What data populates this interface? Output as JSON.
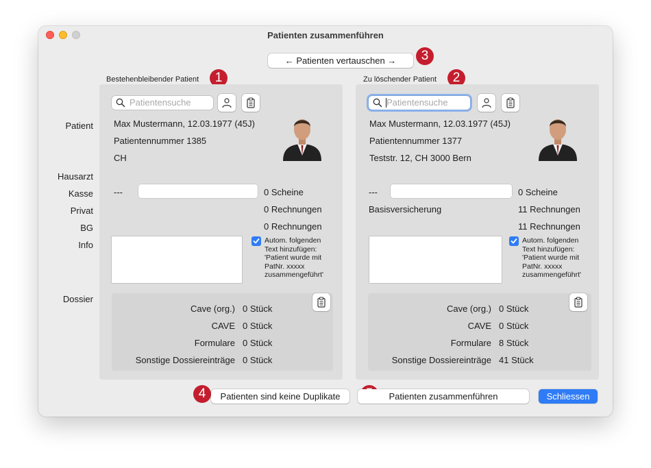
{
  "window": {
    "title": "Patienten zusammenführen"
  },
  "swap_button": "← Patienten vertauschen →",
  "badges": [
    "1",
    "2",
    "3",
    "4",
    "5"
  ],
  "row_labels": {
    "patient": "Patient",
    "hausarzt": "Hausarzt",
    "kasse": "Kasse",
    "privat": "Privat",
    "bg": "BG",
    "info": "Info",
    "dossier": "Dossier"
  },
  "search_placeholder": "Patientensuche",
  "left": {
    "heading": "Bestehenbleibender Patient",
    "name_line": "Max Mustermann, 12.03.1977 (45J)",
    "patnr_line": "Patientennummer 1385",
    "address_line": "CH",
    "kasse_value": "---",
    "kasse_insurance": "",
    "scheine": "0 Scheine",
    "privat_rechnungen": "0 Rechnungen",
    "bg_rechnungen": "0 Rechnungen",
    "auto_text": [
      "Autom. folgenden",
      "Text hinzufügen:",
      "'Patient wurde mit",
      "PatNr. xxxxx",
      "zusammengeführt'"
    ],
    "auto_checked": true,
    "dossier": [
      {
        "label": "Cave (org.)",
        "value": "0 Stück"
      },
      {
        "label": "CAVE",
        "value": "0 Stück"
      },
      {
        "label": "Formulare",
        "value": "0 Stück"
      },
      {
        "label": "Sonstige Dossiereinträge",
        "value": "0 Stück"
      }
    ]
  },
  "right": {
    "heading": "Zu löschender Patient",
    "name_line": "Max Mustermann, 12.03.1977 (45J)",
    "patnr_line": "Patientennummer 1377",
    "address_line": "Teststr. 12, CH 3000 Bern",
    "kasse_value": "---",
    "kasse_insurance": "Basisversicherung",
    "scheine": "0 Scheine",
    "privat_rechnungen": "11 Rechnungen",
    "bg_rechnungen": "11 Rechnungen",
    "auto_text": [
      "Autom. folgenden",
      "Text hinzufügen:",
      "'Patient wurde mit",
      "PatNr. xxxxx",
      "zusammengeführt'"
    ],
    "auto_checked": true,
    "dossier": [
      {
        "label": "Cave (org.)",
        "value": "0 Stück"
      },
      {
        "label": "CAVE",
        "value": "0 Stück"
      },
      {
        "label": "Formulare",
        "value": "8 Stück"
      },
      {
        "label": "Sonstige Dossiereinträge",
        "value": "41 Stück"
      }
    ]
  },
  "footer": {
    "no_duplicates": "Patienten sind keine Duplikate",
    "merge": "Patienten zusammenführen",
    "close": "Schliessen"
  },
  "colors": {
    "badge": "#c41e2e",
    "accent": "#2f7cf6",
    "panel": "#dedede"
  }
}
